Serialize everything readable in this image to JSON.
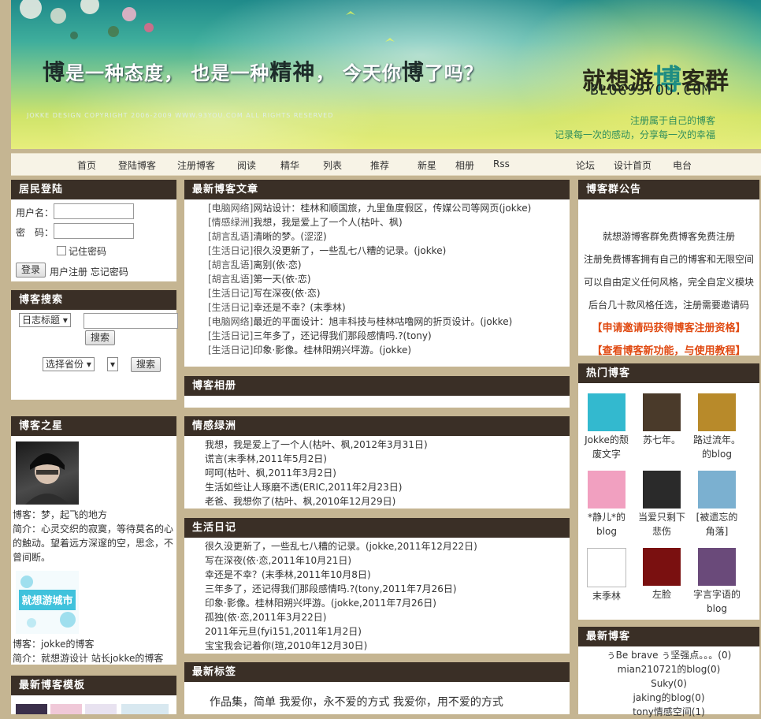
{
  "banner": {
    "slogan": [
      {
        "text": "博",
        "big": true
      },
      {
        "text": "是一种态度，",
        "big": false
      },
      {
        "text": "  也是一种",
        "big": false
      },
      {
        "text": "精神",
        "big": true
      },
      {
        "text": "，  今天你",
        "big": false
      },
      {
        "text": "博",
        "big": true
      },
      {
        "text": "了吗？",
        "big": false
      }
    ],
    "copyright": "JOKKE DESIGN  COPYRIGHT  2006-2009 WWW.93YOU.COM  ALL RIGHTS RESERVED",
    "logo_pre": "就想游",
    "logo_hl": "博",
    "logo_post": "客群",
    "logo_sub": "BLOG93YOU.COM",
    "tagline1": "注册属于自己的博客",
    "tagline2": "记录每一次的感动，分享每一次的幸福"
  },
  "nav": [
    "首页",
    "登陆博客",
    "注册博客",
    "阅读",
    "精华",
    "列表",
    "推荐",
    "新星",
    "相册",
    "Rss",
    "论坛",
    "设计首页",
    "电台"
  ],
  "login": {
    "title": "居民登陆",
    "username_label": "用户名：",
    "password_label": "密　码：",
    "remember": "记住密码",
    "login_btn": "登录",
    "register": "用户注册",
    "forgot": "忘记密码"
  },
  "search": {
    "title": "博客搜索",
    "type_select": "日志标题",
    "btn": "搜索",
    "province_select": "选择省份",
    "city_select": "",
    "btn2": "搜索"
  },
  "star": {
    "title": "博客之星",
    "people": [
      {
        "name": "博客：梦，起飞的地方",
        "intro": "简介：心灵交织的寂寞，等待莫名的心的触动。望着远方深邃的空，思念，不曾间断。"
      },
      {
        "name": "博客：jokke的博客",
        "intro": "简介：就想游设计 站长jokke的博客"
      }
    ]
  },
  "templates": {
    "title": "最新博客模板"
  },
  "latest_articles": {
    "title": "最新博客文章",
    "items": [
      {
        "cat": "[电脑网络]",
        "title": "网站设计：桂林和顺国旅，九里鱼度假区，传媒公司等网页(jokke)"
      },
      {
        "cat": "[情感绿洲]",
        "title": "我想，我是爱上了一个人(枯叶、枫)"
      },
      {
        "cat": "[胡言乱语]",
        "title": "清晰的梦。(涩涩)"
      },
      {
        "cat": "[生活日记]",
        "title": "很久没更新了，一些乱七八糟的记录。(jokke)"
      },
      {
        "cat": "[胡言乱语]",
        "title": "离别(依·恋)"
      },
      {
        "cat": "[胡言乱语]",
        "title": "第一天(依·恋)"
      },
      {
        "cat": "[生活日记]",
        "title": "写在深夜(依·恋)"
      },
      {
        "cat": "[生活日记]",
        "title": "幸还是不幸？(末季林)"
      },
      {
        "cat": "[电脑网络]",
        "title": "最近的平面设计：旭丰科技与桂林咕噜网的折页设计。(jokke)"
      },
      {
        "cat": "[生活日记]",
        "title": "三年多了，还记得我们那段感情吗.?(tony)"
      },
      {
        "cat": "[生活日记]",
        "title": "印象·影像。桂林阳朔兴坪游。(jokke)"
      }
    ]
  },
  "album": {
    "title": "博客相册"
  },
  "emotion": {
    "title": "情感绿洲",
    "items": [
      "我想，我是爱上了一个人(枯叶、枫,2012年3月31日)",
      "谎言(末季林,2011年5月2日)",
      "呵呵(枯叶、枫,2011年3月2日)",
      "生活如些让人琢磨不透(ERIC,2011年2月23日)",
      "老爸、我想你了(枯叶、枫,2010年12月29日)"
    ]
  },
  "diary": {
    "title": "生活日记",
    "items": [
      "很久没更新了，一些乱七八糟的记录。(jokke,2011年12月22日)",
      "写在深夜(依·恋,2011年10月21日)",
      "幸还是不幸？(末季林,2011年10月8日)",
      "三年多了，还记得我们那段感情吗.?(tony,2011年7月26日)",
      "印象·影像。桂林阳朔兴坪游。(jokke,2011年7月26日)",
      "孤独(依·恋,2011年3月22日)",
      "2011年元旦(fyi151,2011年1月2日)",
      "宝宝我会记着你(瑄,2010年12月30日)"
    ]
  },
  "tags": {
    "title": "最新标签",
    "text": "作品集，简单  我爱你，永不爱的方式  我爱你，用不爱的方式"
  },
  "notice": {
    "title": "博客群公告",
    "lines": [
      "就想游博客群免费博客免费注册",
      "注册免费博客拥有自己的博客和无限空间",
      "可以自由定义任何风格，完全自定义模块",
      "后台几十款风格任选，注册需要邀请码"
    ],
    "red_links": [
      "【申请邀请码获得博客注册资格】",
      "【查看博客新功能，与使用教程】"
    ]
  },
  "hot": {
    "title": "热门博客",
    "items": [
      {
        "name": "Jokke的颓废文字",
        "color": "#33b9cf"
      },
      {
        "name": "苏七年。",
        "color": "#4a3a2a"
      },
      {
        "name": "路过流年。的blog",
        "color": "#b88a2a"
      },
      {
        "name": "*静儿*的blog",
        "color": "#f1a0c0"
      },
      {
        "name": "当爱只剩下悲伤",
        "color": "#2a2a2a"
      },
      {
        "name": "[被遗忘的角落]",
        "color": "#7bb0d0"
      },
      {
        "name": "末季林",
        "color": "#ffffff"
      },
      {
        "name": "左脸",
        "color": "#7a1010"
      },
      {
        "name": "字言字语的blog",
        "color": "#6a4a7a"
      }
    ]
  },
  "newest": {
    "title": "最新博客",
    "items": [
      "ぅBe brave ぅ坚强点。。。(0)",
      "mian210721的blog(0)",
      "Suky(0)",
      "jaking的blog(0)",
      "tony情感空间(1)"
    ]
  }
}
